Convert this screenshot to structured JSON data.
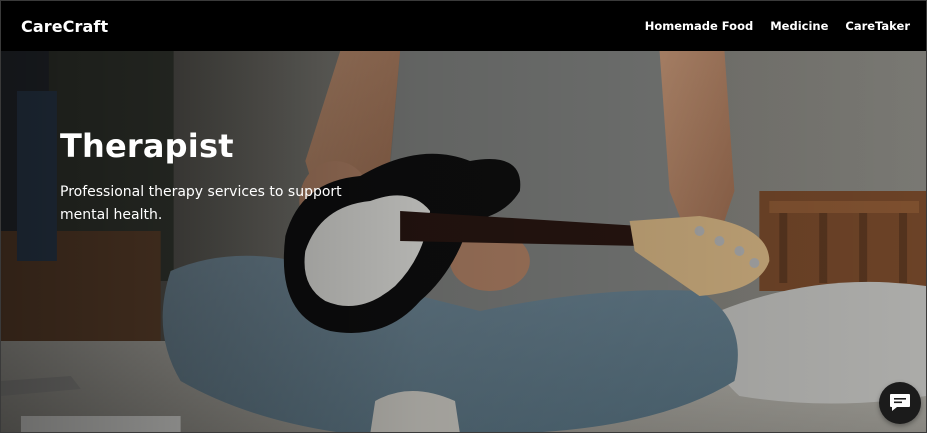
{
  "navbar": {
    "brand": "CareCraft",
    "links": [
      {
        "label": "Homemade Food"
      },
      {
        "label": "Medicine"
      },
      {
        "label": "CareTaker"
      }
    ]
  },
  "hero": {
    "title": "Therapist",
    "subtitle": "Professional therapy services to support mental health.",
    "image": "man-playing-electric-guitar-on-bed"
  },
  "chat": {
    "icon": "chat-bubble-icon"
  },
  "colors": {
    "navbar_bg": "#000000",
    "text": "#ffffff",
    "chat_button_bg": "#1b1b1b"
  }
}
